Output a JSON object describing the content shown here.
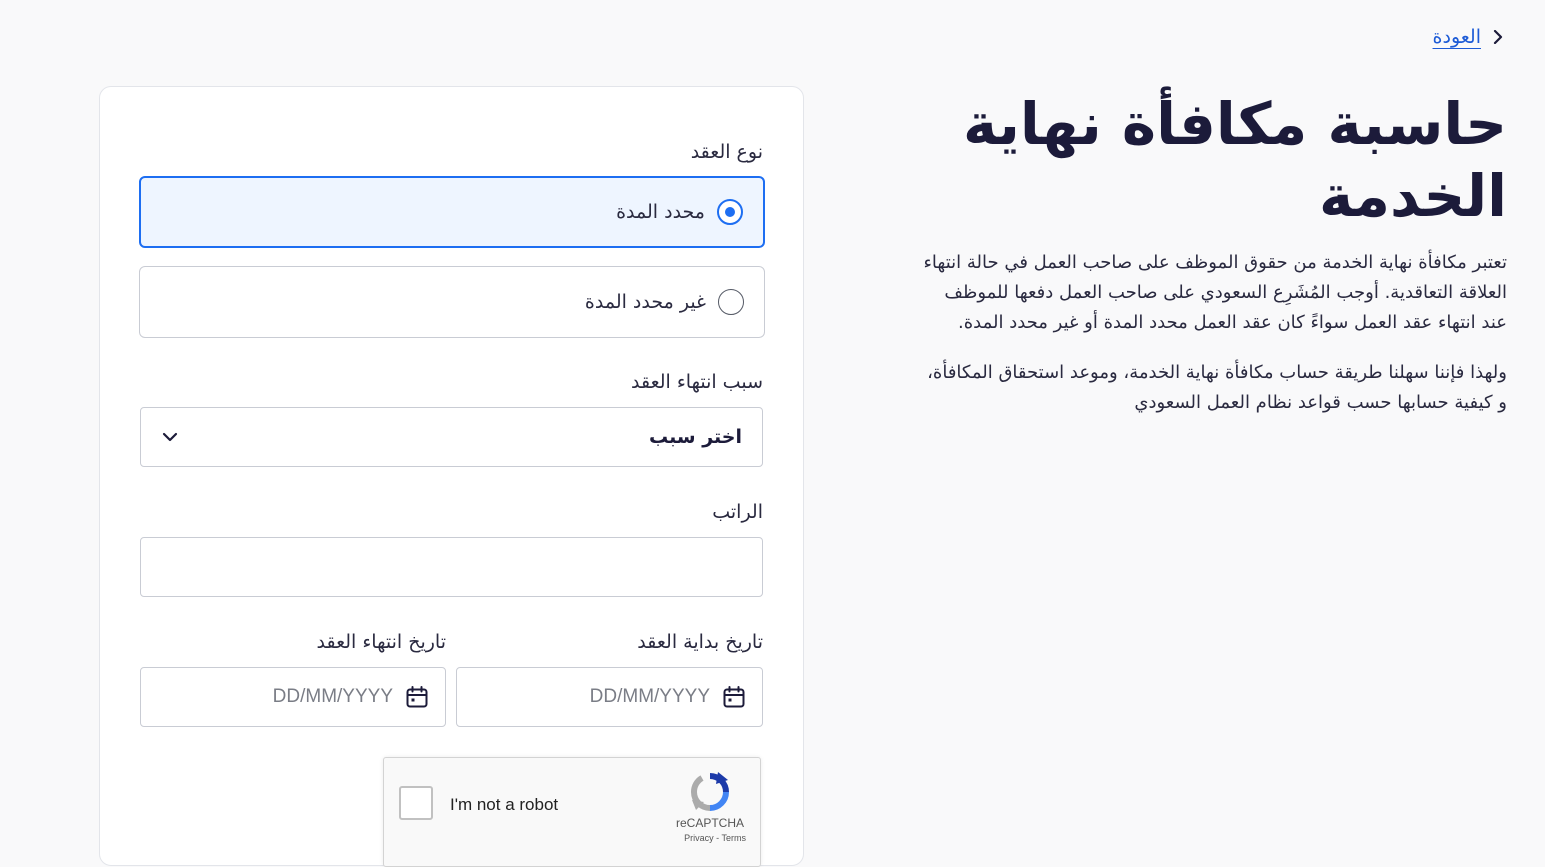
{
  "back_link": {
    "label": "العودة"
  },
  "intro": {
    "title": "حاسبة مكافأة نهاية الخدمة",
    "paragraph_1": "تعتبر مكافأة نهاية الخدمة من حقوق الموظف على صاحب العمل في حالة انتهاء العلاقة التعاقدية. أوجب المُشَرِع السعودي على صاحب العمل دفعها للموظف عند انتهاء عقد العمل سواءً كان عقد العمل محدد المدة أو غير محدد المدة.",
    "paragraph_2": "ولهذا فإننا سهلنا طريقة حساب مكافأة نهاية الخدمة، وموعد استحقاق المكافأة، و كيفية حسابها حسب قواعد نظام العمل السعودي"
  },
  "form": {
    "contract_type": {
      "label": "نوع العقد",
      "options": [
        {
          "label": "محدد المدة",
          "selected": true
        },
        {
          "label": "غير محدد المدة",
          "selected": false
        }
      ]
    },
    "termination_reason": {
      "label": "سبب انتهاء العقد",
      "selected_value": "اختر سبب"
    },
    "salary": {
      "label": "الراتب",
      "value": ""
    },
    "start_date": {
      "label": "تاريخ بداية العقد",
      "placeholder": "DD/MM/YYYY"
    },
    "end_date": {
      "label": "تاريخ انتهاء العقد",
      "placeholder": "DD/MM/YYYY"
    },
    "captcha": {
      "checkbox_label": "I'm not a robot",
      "brand": "reCAPTCHA",
      "links": "Privacy - Terms"
    }
  },
  "colors": {
    "accent": "#1d6ef2",
    "selected_bg": "#eef5ff",
    "link": "#1d5bd6",
    "title": "#1c1b3a"
  }
}
